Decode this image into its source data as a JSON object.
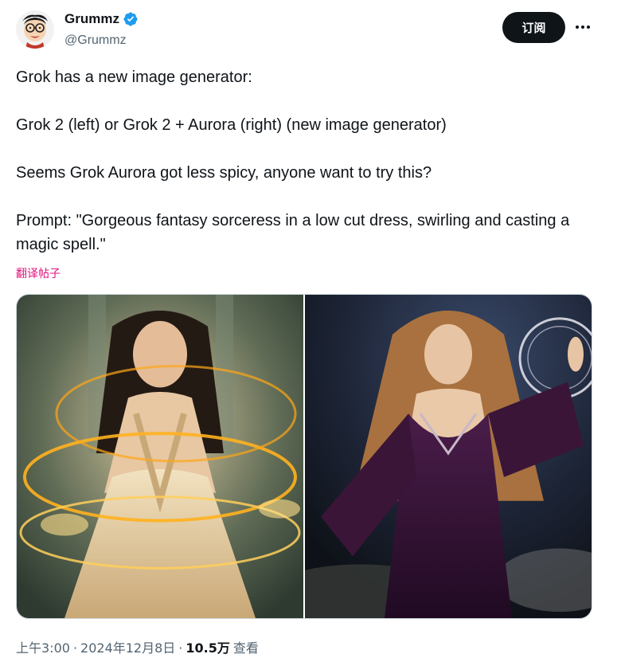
{
  "author": {
    "display_name": "Grummz",
    "handle": "@Grummz",
    "avatar_icon": "cartoon-avatar-icon",
    "verified_icon": "verified-badge-icon",
    "verified_color": "#1d9bf0"
  },
  "actions": {
    "subscribe_label": "订阅",
    "more_icon": "more-dots-icon"
  },
  "tweet": {
    "text": "Grok has a new image generator:\n\nGrok 2 (left) or Grok 2 + Aurora (right) (new image generator)\n\nSeems Grok Aurora got less spicy, anyone want to try this?\n\nPrompt: \"Gorgeous fantasy sorceress in a low cut dress, swirling and casting a magic spell.\"",
    "translate_label": "翻译帖子",
    "translate_color": "#e1137e"
  },
  "media": {
    "images": [
      {
        "position": "left"
      },
      {
        "position": "right"
      }
    ]
  },
  "meta": {
    "time": "上午3:00",
    "separator": "·",
    "date": "2024年12月8日",
    "views": "10.5万",
    "views_label": "查看"
  }
}
